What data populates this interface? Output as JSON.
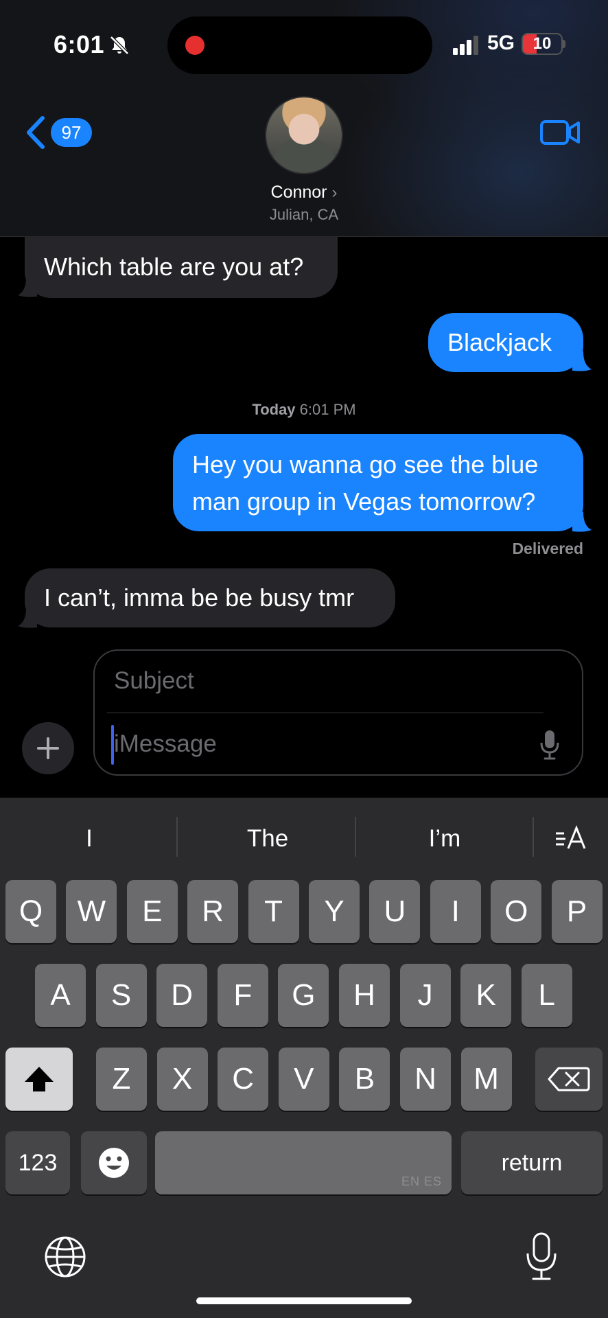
{
  "status_bar": {
    "time": "6:01",
    "network": "5G",
    "battery": "10"
  },
  "header": {
    "unread_count": "97",
    "contact_name": "Connor",
    "contact_location": "Julian, CA"
  },
  "messages": [
    {
      "direction": "incoming",
      "text": "Which table are you at?"
    },
    {
      "direction": "outgoing",
      "text": "Blackjack"
    },
    {
      "direction": "outgoing",
      "line1": "Hey you wanna go see the blue",
      "line2": "man group in Vegas tomorrow?"
    },
    {
      "direction": "incoming",
      "text": "I can’t, imma be be busy tmr"
    }
  ],
  "timestamp": {
    "day": "Today",
    "time": "6:01 PM"
  },
  "delivered_label": "Delivered",
  "compose": {
    "subject_placeholder": "Subject",
    "message_placeholder": "iMessage"
  },
  "keyboard": {
    "suggestions": [
      "I",
      "The",
      "I’m"
    ],
    "row1": [
      "Q",
      "W",
      "E",
      "R",
      "T",
      "Y",
      "U",
      "I",
      "O",
      "P"
    ],
    "row2": [
      "A",
      "S",
      "D",
      "F",
      "G",
      "H",
      "J",
      "K",
      "L"
    ],
    "row3": [
      "Z",
      "X",
      "C",
      "V",
      "B",
      "N",
      "M"
    ],
    "numbers_key": "123",
    "space_languages": "EN ES",
    "return_key": "return"
  },
  "colors": {
    "accent": "#1a84ff",
    "incoming_bubble": "#26262a",
    "recording": "#e5302f"
  }
}
